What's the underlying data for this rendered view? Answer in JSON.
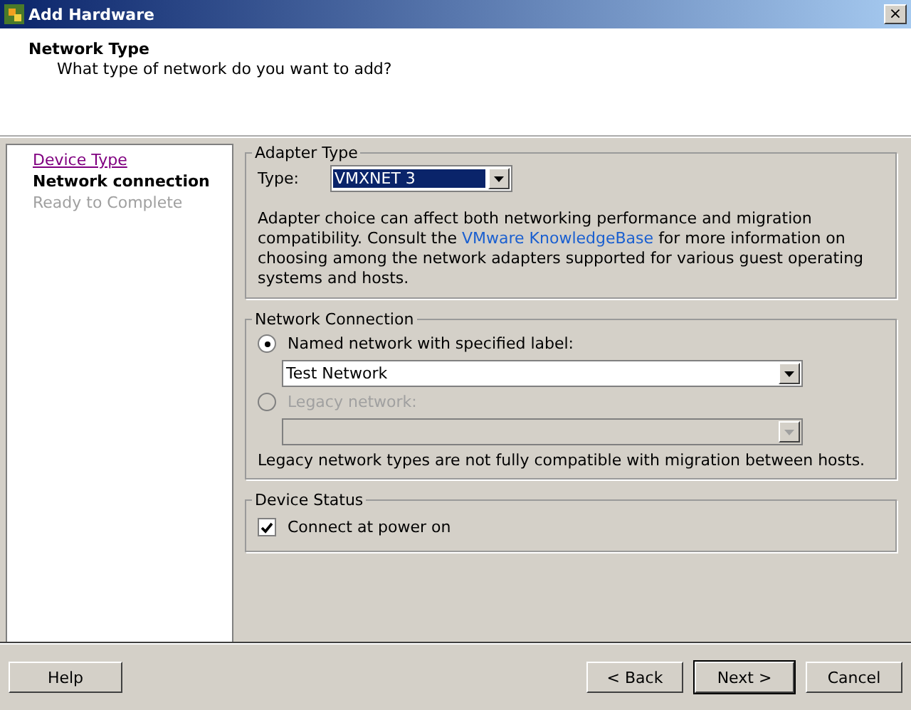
{
  "window": {
    "title": "Add Hardware",
    "close": "×"
  },
  "header": {
    "title": "Network Type",
    "subtitle": "What type of network do you want to add?"
  },
  "steps": [
    {
      "label": "Device Type",
      "kind": "visited"
    },
    {
      "label": "Network connection",
      "kind": "current"
    },
    {
      "label": "Ready to Complete",
      "kind": "future"
    }
  ],
  "adapter_type": {
    "legend": "Adapter Type",
    "label": "Type:",
    "value": "VMXNET 3",
    "focused": true,
    "description_before": "Adapter choice can affect both networking performance and migration compatibility. Consult the",
    "link": "VMware KnowledgeBase",
    "description_after": "for more information on choosing among the network adapters supported for various guest operating systems and hosts."
  },
  "network_connection": {
    "legend": "Network Connection",
    "options": [
      {
        "label": "Named network with specified label:",
        "selected": true,
        "disabled": false,
        "value": "Test Network"
      },
      {
        "label": "Legacy network:",
        "selected": false,
        "disabled": true
      }
    ],
    "note": "Legacy network types are not fully compatible with migration between hosts."
  },
  "device_status": {
    "legend": "Device Status",
    "checkbox": {
      "label": "Connect at power on",
      "checked": true
    }
  },
  "buttons": [
    {
      "label": "Help",
      "default": false
    },
    {
      "label": "< Back",
      "default": false
    },
    {
      "label": "Next >",
      "default": true
    },
    {
      "label": "Cancel",
      "default": false
    }
  ]
}
